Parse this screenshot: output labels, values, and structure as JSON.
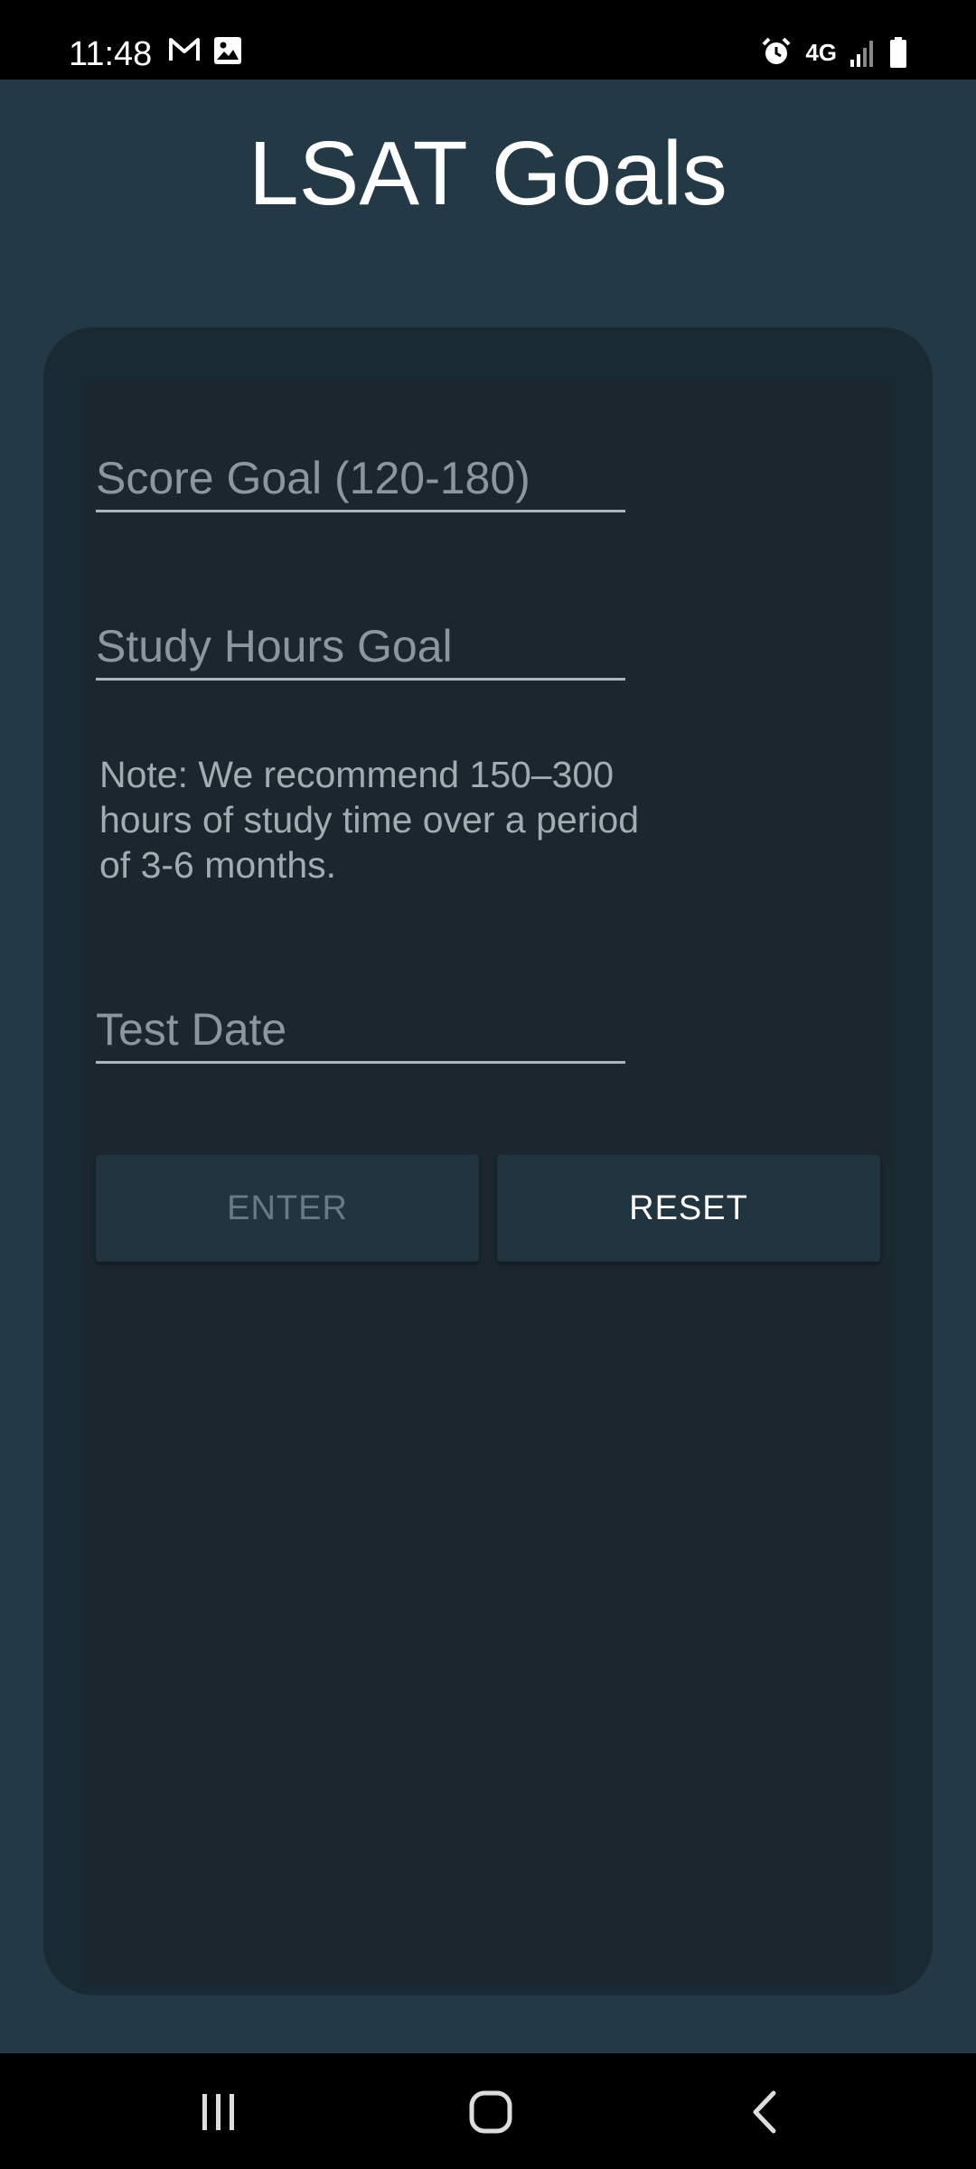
{
  "status_bar": {
    "time": "11:48",
    "left_icons": [
      "gmail-icon",
      "image-icon"
    ],
    "right_icons": [
      "alarm-icon",
      "network-4g-icon",
      "signal-icon",
      "battery-icon"
    ],
    "network_label": "4G"
  },
  "app": {
    "title": "LSAT Goals",
    "colors": {
      "background": "#233a46",
      "card": "#1b262e",
      "button": "#213540"
    },
    "form": {
      "score_goal": {
        "value": "",
        "placeholder": "Score Goal (120-180)"
      },
      "study_hours_goal": {
        "value": "",
        "placeholder": "Study Hours Goal"
      },
      "note": "Note: We recommend 150–300 hours of study time over a period of 3-6 months.",
      "test_date": {
        "value": "",
        "placeholder": "Test Date"
      },
      "enter_label": "ENTER",
      "reset_label": "RESET"
    }
  },
  "nav_bar": {
    "items": [
      "recent-apps-icon",
      "home-icon",
      "back-icon"
    ]
  }
}
